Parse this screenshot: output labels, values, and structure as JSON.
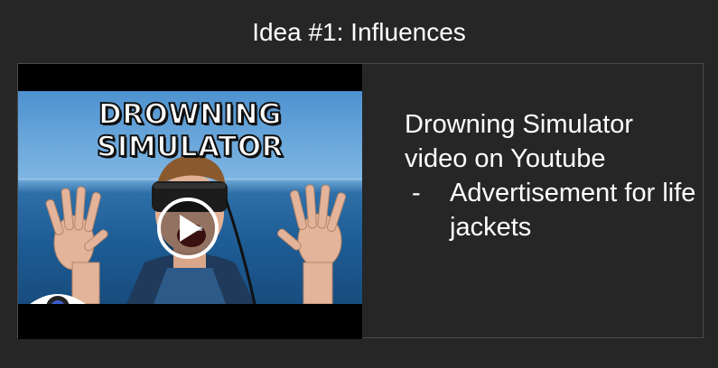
{
  "slide": {
    "title": "Idea #1: Influences",
    "video": {
      "thumbnail_title": "DROWNING SIMULATOR",
      "play_icon": "play-icon",
      "overlay_icon": "eye-icon"
    },
    "caption": "Drowning Simulator video on Youtube",
    "bullets": [
      {
        "marker": "-",
        "text": "Advertisement for life jackets"
      }
    ]
  },
  "colors": {
    "background": "#262626",
    "panel_border": "#4a4a4a",
    "text": "#ffffff",
    "sky": "#7db5e2",
    "sea": "#1e5d96"
  }
}
